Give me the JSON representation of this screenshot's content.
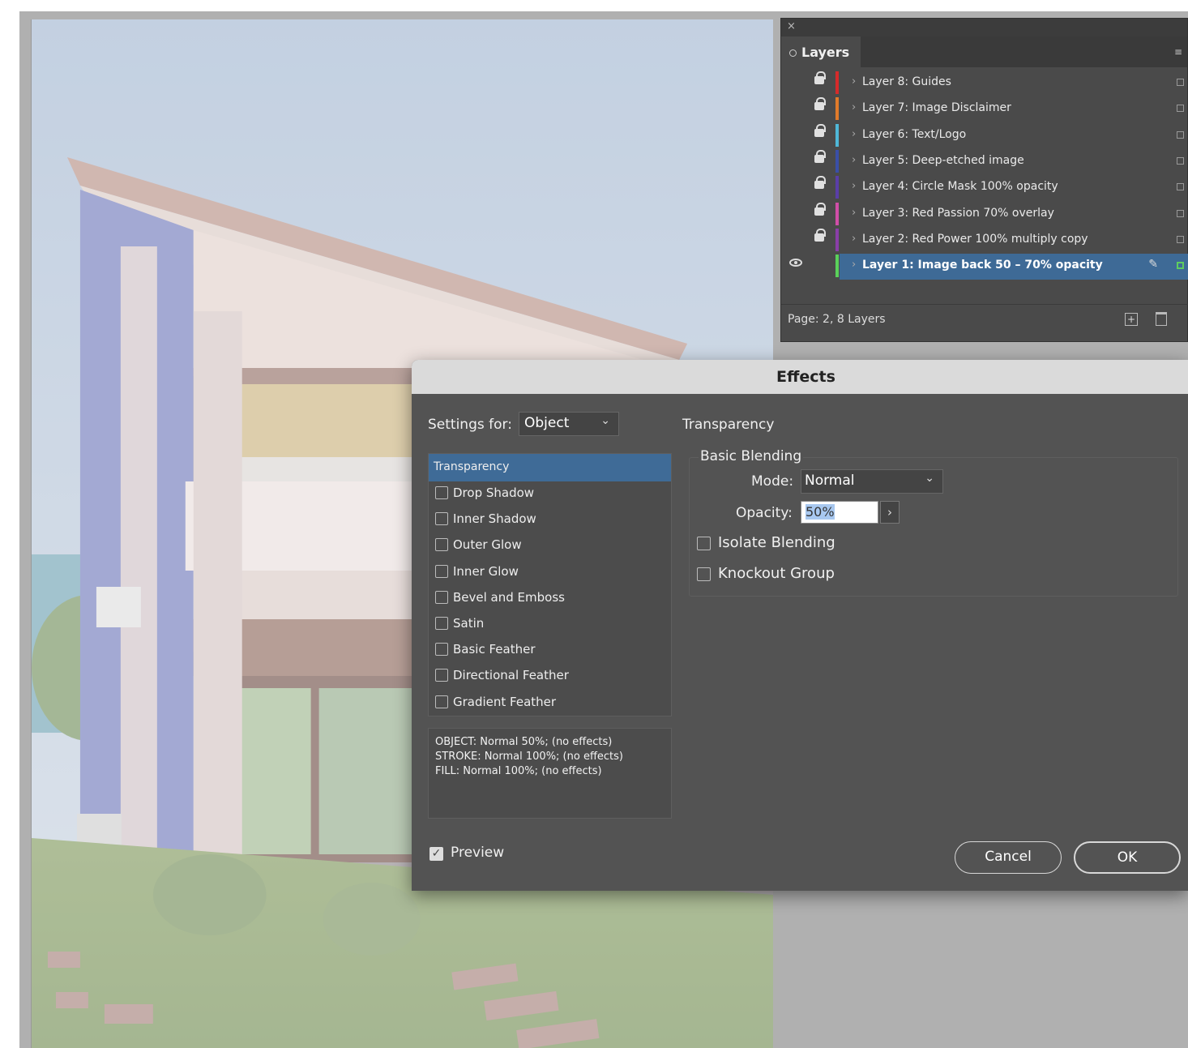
{
  "layers_panel": {
    "tab_label": "Layers",
    "layers": [
      {
        "name": "Layer 8: Guides",
        "color": "#d62a2a",
        "locked": true,
        "visible": false,
        "selected": false
      },
      {
        "name": "Layer 7: Image Disclaimer",
        "color": "#e07a2a",
        "locked": true,
        "visible": false,
        "selected": false
      },
      {
        "name": "Layer 6: Text/Logo",
        "color": "#4fb8d8",
        "locked": true,
        "visible": false,
        "selected": false
      },
      {
        "name": "Layer 5: Deep-etched image",
        "color": "#3a4fa8",
        "locked": true,
        "visible": false,
        "selected": false
      },
      {
        "name": "Layer 4: Circle Mask 100% opacity",
        "color": "#5a3ea8",
        "locked": true,
        "visible": false,
        "selected": false
      },
      {
        "name": "Layer 3: Red Passion 70% overlay",
        "color": "#d04ea8",
        "locked": true,
        "visible": false,
        "selected": false
      },
      {
        "name": "Layer 2: Red Power 100% multiply copy",
        "color": "#8a3ea8",
        "locked": true,
        "visible": false,
        "selected": false
      },
      {
        "name": "Layer 1: Image back 50 – 70% opacity",
        "color": "#5ad05a",
        "locked": false,
        "visible": true,
        "selected": true
      }
    ],
    "footer_text": "Page: 2, 8 Layers"
  },
  "effects_dialog": {
    "title": "Effects",
    "settings_for_label": "Settings for:",
    "settings_for_value": "Object",
    "section_title": "Transparency",
    "effects": [
      {
        "label": "Transparency",
        "active": true
      },
      {
        "label": "Drop Shadow",
        "checked": false
      },
      {
        "label": "Inner Shadow",
        "checked": false
      },
      {
        "label": "Outer Glow",
        "checked": false
      },
      {
        "label": "Inner Glow",
        "checked": false
      },
      {
        "label": "Bevel and Emboss",
        "checked": false
      },
      {
        "label": "Satin",
        "checked": false
      },
      {
        "label": "Basic Feather",
        "checked": false
      },
      {
        "label": "Directional Feather",
        "checked": false
      },
      {
        "label": "Gradient Feather",
        "checked": false
      }
    ],
    "summary": [
      "OBJECT: Normal 50%; (no effects)",
      "STROKE: Normal 100%; (no effects)",
      "FILL: Normal 100%; (no effects)"
    ],
    "basic_blending": {
      "title": "Basic Blending",
      "mode_label": "Mode:",
      "mode_value": "Normal",
      "opacity_label": "Opacity:",
      "opacity_value": "50%",
      "isolate_blending": "Isolate Blending",
      "knockout_group": "Knockout Group"
    },
    "preview_label": "Preview",
    "preview_checked": true,
    "cancel_label": "Cancel",
    "ok_label": "OK"
  }
}
